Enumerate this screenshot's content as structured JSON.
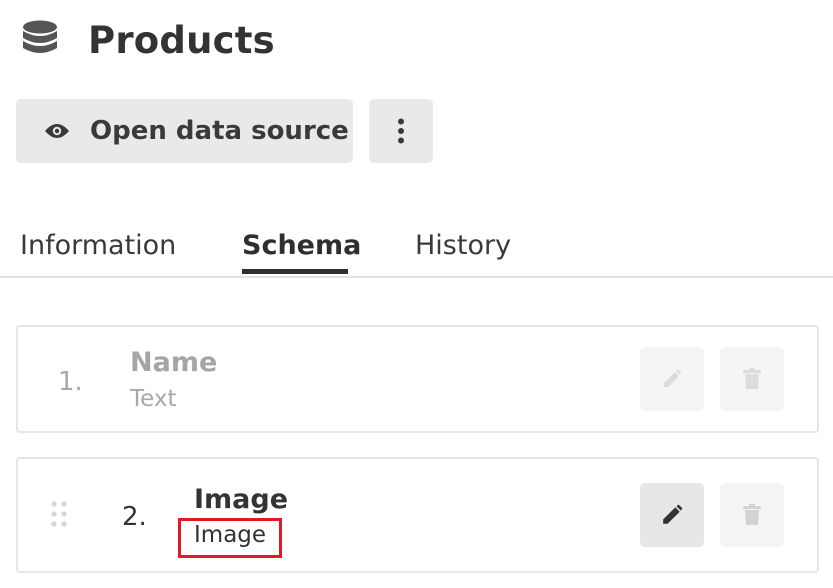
{
  "header": {
    "title": "Products",
    "icon": "database-icon"
  },
  "actions": {
    "open_label": "Open data source",
    "open_icon": "eye-icon",
    "more_icon": "more-vertical-icon"
  },
  "tabs": [
    {
      "label": "Information",
      "active": false
    },
    {
      "label": "Schema",
      "active": true
    },
    {
      "label": "History",
      "active": false
    }
  ],
  "fields": [
    {
      "index": "1.",
      "name": "Name",
      "type": "Text",
      "disabled": true
    },
    {
      "index": "2.",
      "name": "Image",
      "type": "Image",
      "disabled": false
    }
  ],
  "colors": {
    "highlight": "#e01b24",
    "button_bg": "#e9e9e9"
  }
}
